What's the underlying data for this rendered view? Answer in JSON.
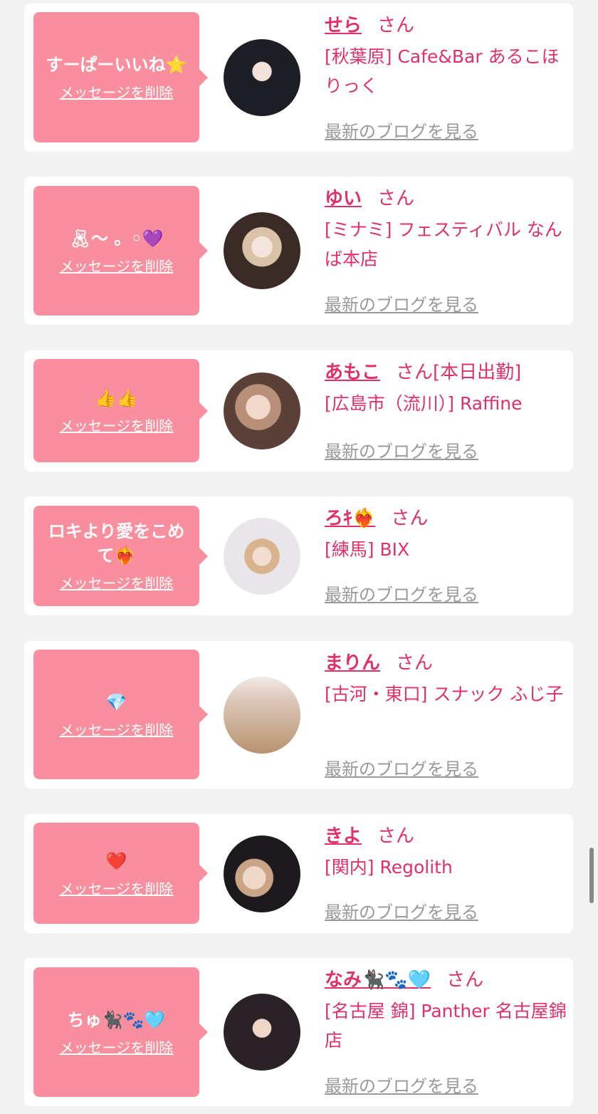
{
  "delete_label": "メッセージを削除",
  "blog_label": "最新のブログを見る",
  "san_label": "さん",
  "colors": {
    "background": "#f2f2f2",
    "bubble": "#f98f9e",
    "accent": "#e0306a",
    "muted": "#999999"
  },
  "cards": [
    {
      "message": "すーぱーいいね⭐️",
      "name": "せら",
      "status": "",
      "shop": "[秋葉原] Cafe&Bar あるこほりっく"
    },
    {
      "message": "🧸︎〜 。◦💜",
      "name": "ゆい",
      "status": "",
      "shop": "[ミナミ] フェスティバル なんば本店"
    },
    {
      "message": "👍👍",
      "name": "あもこ",
      "status": "[本日出勤]",
      "shop": "[広島市（流川）] Raffine"
    },
    {
      "message": "ロキより愛をこめて❤️‍🔥",
      "name": "ろｷ❤️‍🔥",
      "status": "",
      "shop": "[練馬] BIX"
    },
    {
      "message": "💎",
      "name": "まりん",
      "status": "",
      "shop": "[古河・東口] スナック ふじ子"
    },
    {
      "message": "❤️",
      "name": "きよ",
      "status": "",
      "shop": "[関内] Regolith"
    },
    {
      "message": "ちゅ🐈‍⬛🐾🩵",
      "name": "なみ🐈‍⬛🐾🩵",
      "status": "",
      "shop": "[名古屋 錦] Panther 名古屋錦店"
    }
  ]
}
